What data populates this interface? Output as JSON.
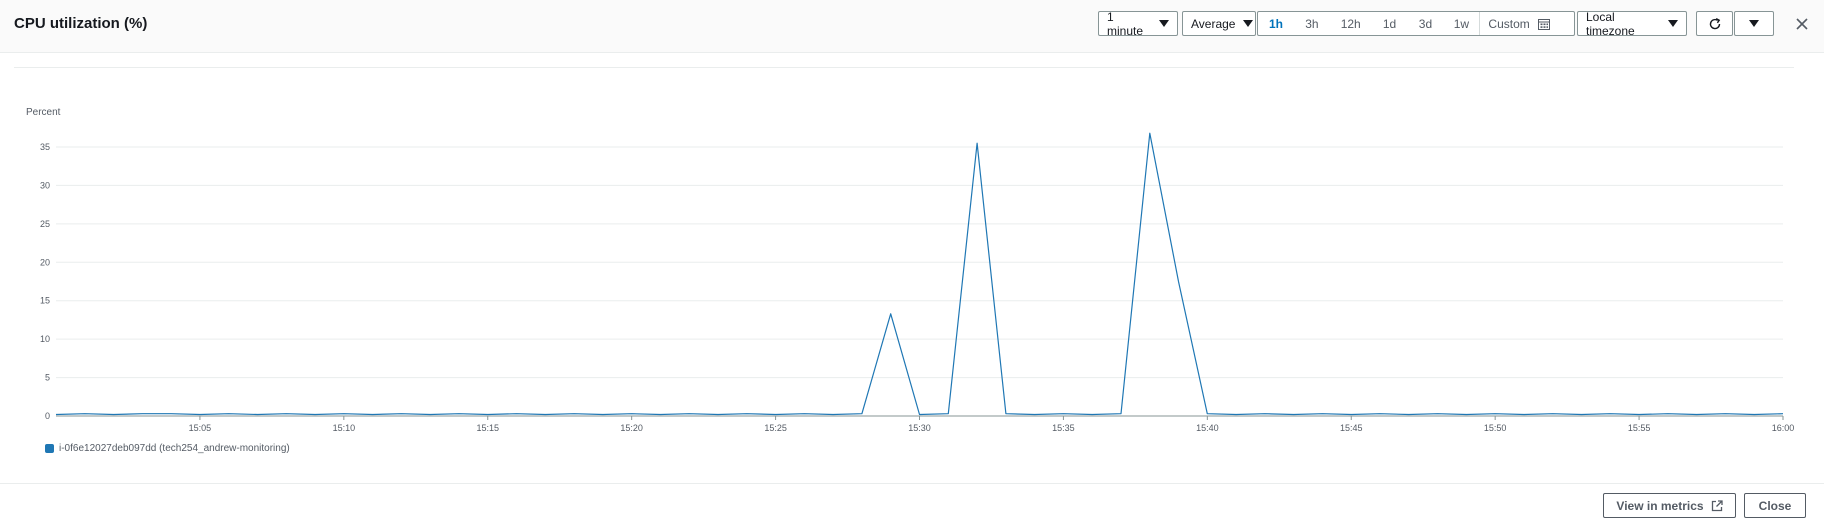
{
  "header": {
    "title": "CPU utilization (%)",
    "period": "1 minute",
    "statistic": "Average",
    "ranges": [
      "1h",
      "3h",
      "12h",
      "1d",
      "3d",
      "1w"
    ],
    "active_range": "1h",
    "custom_label": "Custom",
    "timezone": "Local timezone"
  },
  "chart_data": {
    "type": "line",
    "ylabel": "Percent",
    "ylim": [
      0,
      35
    ],
    "yticks": [
      0,
      5,
      10,
      15,
      20,
      25,
      30,
      35
    ],
    "xticks": [
      "15:05",
      "15:10",
      "15:15",
      "15:20",
      "15:25",
      "15:30",
      "15:35",
      "15:40",
      "15:45",
      "15:50",
      "15:55",
      "16:00"
    ],
    "x_start": "15:00",
    "x_end": "16:00",
    "series": [
      {
        "name": "i-0f6e12027deb097dd (tech254_andrew-monitoring)",
        "color": "#1f77b4",
        "x": [
          "15:00",
          "15:01",
          "15:02",
          "15:03",
          "15:04",
          "15:05",
          "15:06",
          "15:07",
          "15:08",
          "15:09",
          "15:10",
          "15:11",
          "15:12",
          "15:13",
          "15:14",
          "15:15",
          "15:16",
          "15:17",
          "15:18",
          "15:19",
          "15:20",
          "15:21",
          "15:22",
          "15:23",
          "15:24",
          "15:25",
          "15:26",
          "15:27",
          "15:28",
          "15:29",
          "15:30",
          "15:31",
          "15:32",
          "15:33",
          "15:34",
          "15:35",
          "15:36",
          "15:37",
          "15:38",
          "15:39",
          "15:40",
          "15:41",
          "15:42",
          "15:43",
          "15:44",
          "15:45",
          "15:46",
          "15:47",
          "15:48",
          "15:49",
          "15:50",
          "15:51",
          "15:52",
          "15:53",
          "15:54",
          "15:55",
          "15:56",
          "15:57",
          "15:58",
          "15:59",
          "16:00"
        ],
        "values": [
          0.2,
          0.3,
          0.2,
          0.3,
          0.3,
          0.2,
          0.3,
          0.2,
          0.3,
          0.2,
          0.3,
          0.2,
          0.3,
          0.2,
          0.3,
          0.2,
          0.3,
          0.2,
          0.3,
          0.2,
          0.3,
          0.2,
          0.3,
          0.2,
          0.3,
          0.2,
          0.3,
          0.2,
          0.3,
          13.3,
          0.2,
          0.3,
          35.5,
          0.3,
          0.2,
          0.3,
          0.2,
          0.3,
          36.8,
          17.5,
          0.3,
          0.2,
          0.3,
          0.2,
          0.3,
          0.2,
          0.3,
          0.2,
          0.3,
          0.2,
          0.3,
          0.2,
          0.3,
          0.2,
          0.3,
          0.2,
          0.3,
          0.2,
          0.3,
          0.2,
          0.3
        ]
      }
    ]
  },
  "footer": {
    "view_metrics": "View in metrics",
    "close": "Close"
  }
}
